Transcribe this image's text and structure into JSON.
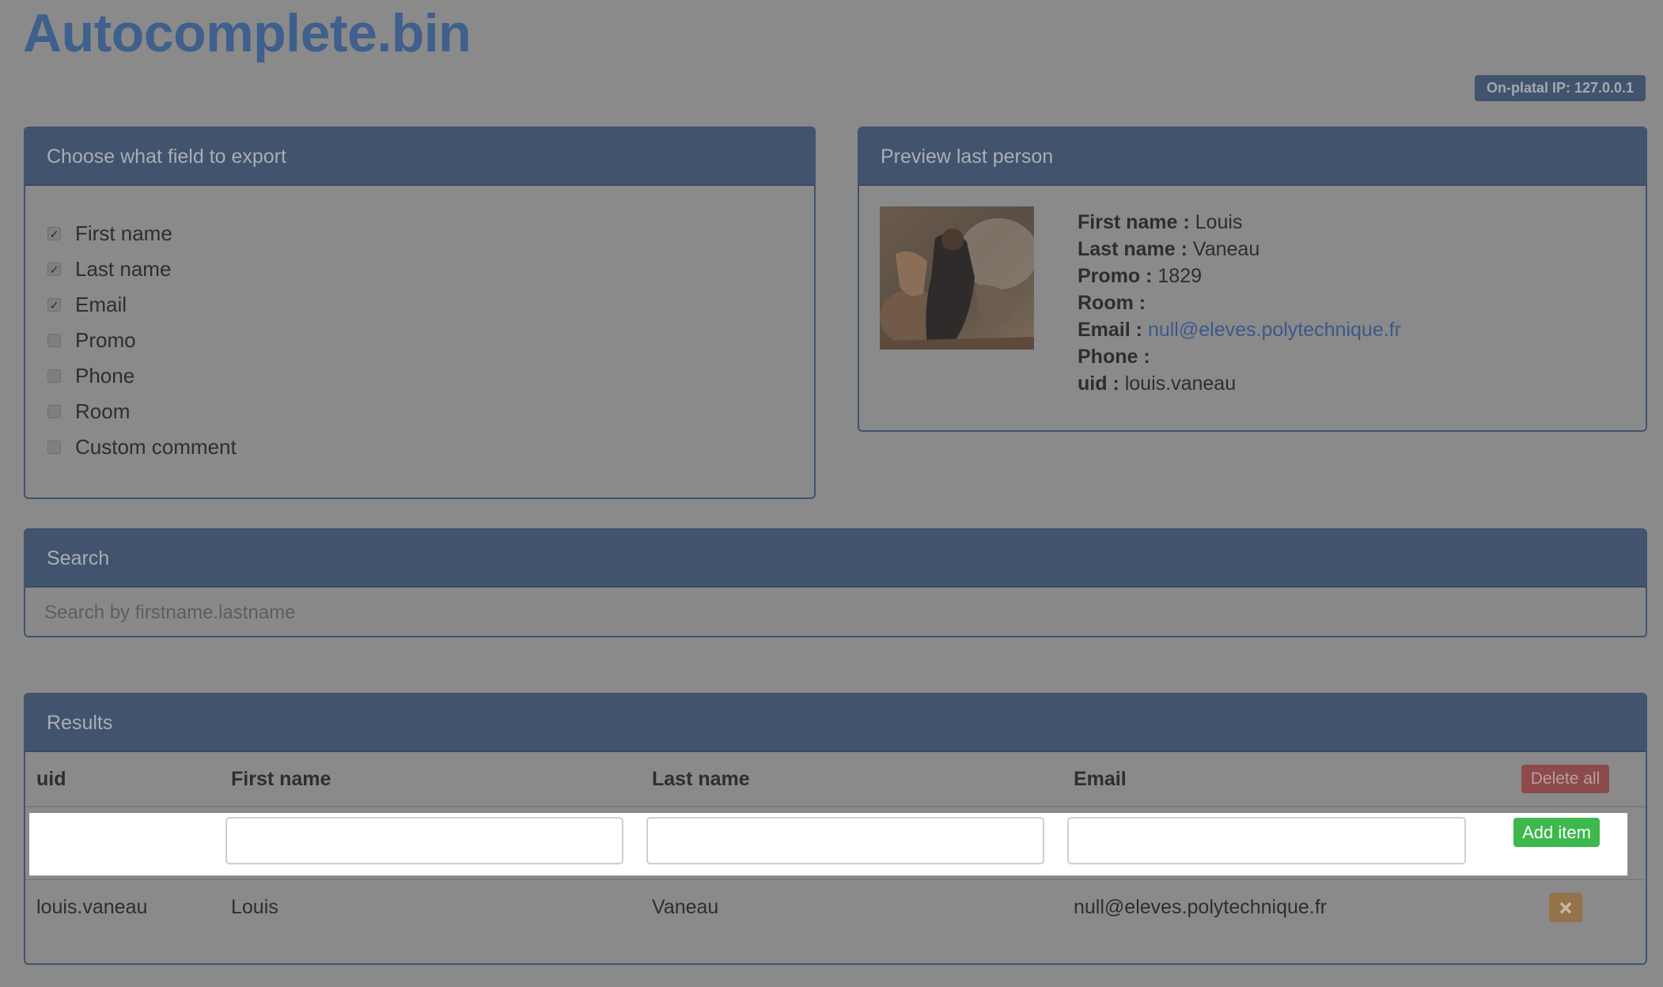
{
  "app": {
    "title": "Autocomplete.bin",
    "ip_badge": "On-platal IP: 127.0.0.1"
  },
  "export": {
    "heading": "Choose what field to export",
    "fields": [
      {
        "label": "First name",
        "checked": true
      },
      {
        "label": "Last name",
        "checked": true
      },
      {
        "label": "Email",
        "checked": true
      },
      {
        "label": "Promo",
        "checked": false
      },
      {
        "label": "Phone",
        "checked": false
      },
      {
        "label": "Room",
        "checked": false
      },
      {
        "label": "Custom comment",
        "checked": false
      }
    ]
  },
  "preview": {
    "heading": "Preview last person",
    "first_name_label": "First name :",
    "first_name": "Louis",
    "last_name_label": "Last name :",
    "last_name": "Vaneau",
    "promo_label": "Promo :",
    "promo": "1829",
    "room_label": "Room :",
    "room": "",
    "email_label": "Email :",
    "email": "null@eleves.polytechnique.fr",
    "phone_label": "Phone :",
    "phone": "",
    "uid_label": "uid :",
    "uid": "louis.vaneau"
  },
  "search": {
    "heading": "Search",
    "placeholder": "Search by firstname.lastname"
  },
  "results": {
    "heading": "Results",
    "columns": [
      "uid",
      "First name",
      "Last name",
      "Email"
    ],
    "delete_all_label": "Delete all",
    "add_item_label": "Add item",
    "rows": [
      {
        "uid": "louis.vaneau",
        "first_name": "Louis",
        "last_name": "Vaneau",
        "email": "null@eleves.polytechnique.fr"
      }
    ],
    "row_delete_icon": "close-icon"
  },
  "colors": {
    "panel_heading": "#41536d",
    "title": "#3f5f8c",
    "delete_all": "#8c4a4a",
    "add_item": "#3cb84c",
    "row_delete": "#94734b"
  }
}
